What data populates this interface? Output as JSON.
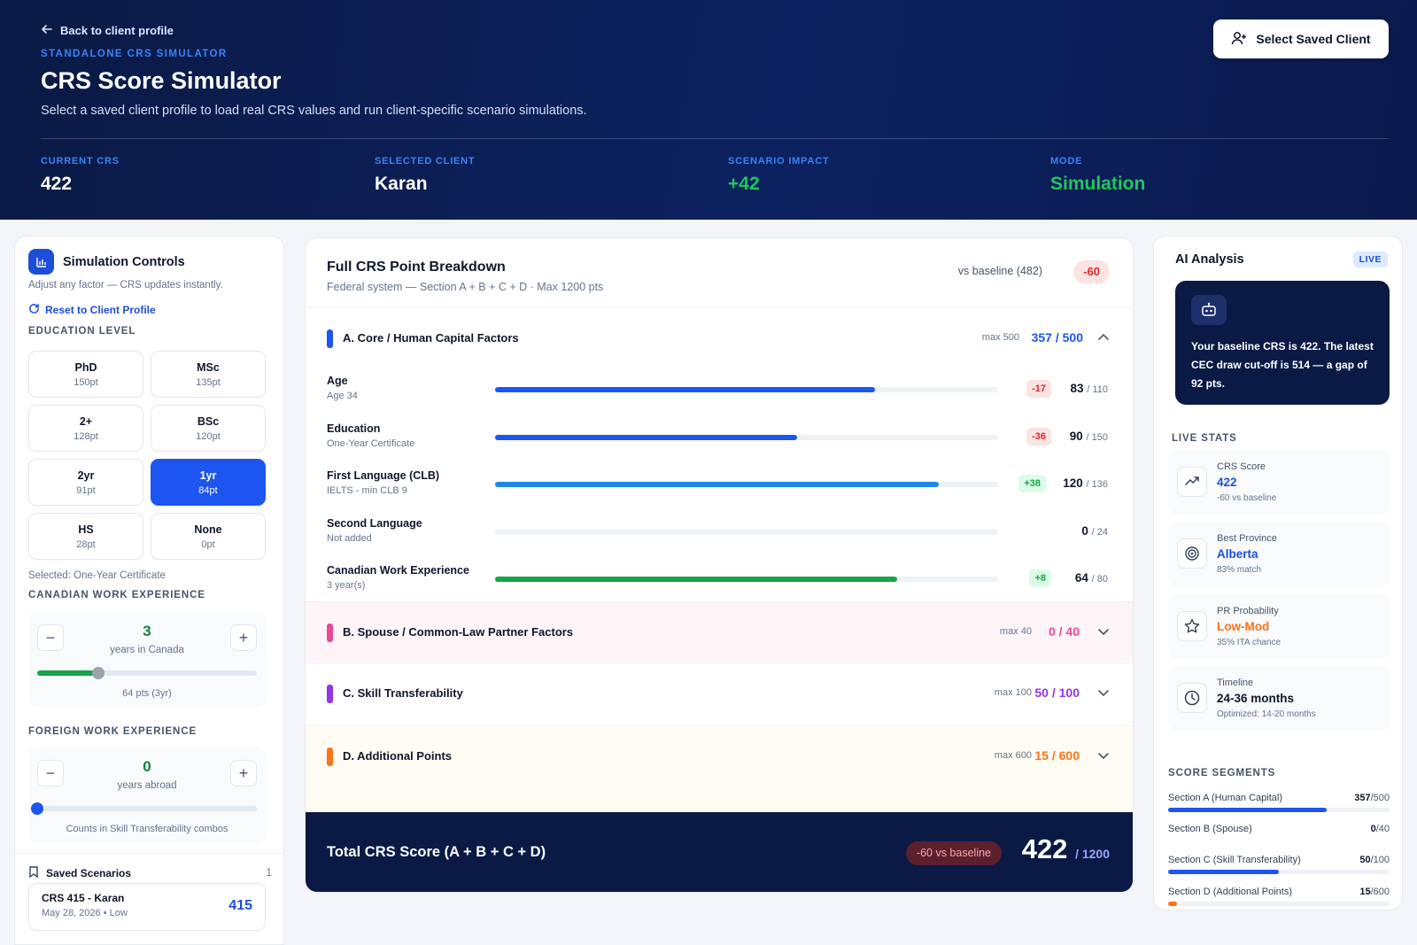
{
  "header": {
    "back_label": "Back to client profile",
    "eyebrow": "STANDALONE CRS SIMULATOR",
    "title": "CRS Score Simulator",
    "subtitle": "Select a saved client profile to load real CRS values and run client-specific scenario simulations.",
    "select_client_label": "Select Saved Client",
    "stats": [
      {
        "label": "CURRENT CRS",
        "value": "422"
      },
      {
        "label": "SELECTED CLIENT",
        "value": "Karan"
      },
      {
        "label": "SCENARIO IMPACT",
        "value": "+42"
      },
      {
        "label": "MODE",
        "value": "Simulation"
      }
    ]
  },
  "controls": {
    "title": "Simulation Controls",
    "description": "Adjust any factor — CRS updates instantly.",
    "reset_label": "Reset to Client Profile",
    "education_label": "EDUCATION LEVEL",
    "education_options": [
      {
        "name": "PhD",
        "points": "150pt"
      },
      {
        "name": "MSc",
        "points": "135pt"
      },
      {
        "name": "2+",
        "points": "128pt"
      },
      {
        "name": "BSc",
        "points": "120pt"
      },
      {
        "name": "2yr",
        "points": "91pt"
      },
      {
        "name": "1yr",
        "points": "84pt"
      },
      {
        "name": "HS",
        "points": "28pt"
      },
      {
        "name": "None",
        "points": "0pt"
      }
    ],
    "education_selected_index": 5,
    "education_selected_note": "Selected: One-Year Certificate",
    "canadian_work": {
      "label": "CANADIAN WORK EXPERIENCE",
      "value": "3",
      "unit": "years in Canada",
      "note": "64 pts (3yr)",
      "level": 0.28
    },
    "foreign_work": {
      "label": "FOREIGN WORK EXPERIENCE",
      "value": "0",
      "unit": "years abroad",
      "note": "Counts in Skill Transferability combos",
      "level": 0
    },
    "saved": {
      "label": "Saved Scenarios",
      "count": "1",
      "items": [
        {
          "title": "CRS 415 - Karan",
          "meta": "May 28, 2026 • Low",
          "score": "415"
        }
      ]
    }
  },
  "breakdown": {
    "title": "Full CRS Point Breakdown",
    "subtitle": "Federal system — Section A + B + C + D · Max 1200 pts",
    "vs_label": "vs baseline (482)",
    "vs_delta": "-60",
    "sections": [
      {
        "name": "A. Core / Human Capital Factors",
        "max": "max 500",
        "score": "357 / 500",
        "color": "#1d55f0"
      },
      {
        "name": "B. Spouse / Common-Law Partner Factors",
        "max": "max 40",
        "score": "0 / 40",
        "color": "#ec4899"
      },
      {
        "name": "C. Skill Transferability",
        "max": "max 100",
        "score": "50 / 100",
        "color": "#9333ea"
      },
      {
        "name": "D. Additional Points",
        "max": "max 600",
        "score": "15 / 600",
        "color": "#f97316"
      }
    ],
    "factors": [
      {
        "name": "Age",
        "detail": "Age 34",
        "delta": "-17",
        "score": "83",
        "max": "/ 110",
        "value": 83,
        "max_value": 110,
        "color": "#1d55f0"
      },
      {
        "name": "Education",
        "detail": "One-Year Certificate",
        "delta": "-36",
        "score": "90",
        "max": "/ 150",
        "value": 90,
        "max_value": 150,
        "color": "#1d55f0"
      },
      {
        "name": "First Language (CLB)",
        "detail": "IELTS - min CLB 9",
        "delta": "+38",
        "score": "120",
        "max": "/ 136",
        "value": 120,
        "max_value": 136,
        "color": "#1e88e5"
      },
      {
        "name": "Second Language",
        "detail": "Not added",
        "delta": "",
        "score": "0",
        "max": "/ 24",
        "value": 0,
        "max_value": 24,
        "color": "#1d55f0"
      },
      {
        "name": "Canadian Work Experience",
        "detail": "3 year(s)",
        "delta": "+8",
        "score": "64",
        "max": "/ 80",
        "value": 64,
        "max_value": 80,
        "color": "#16a34a"
      }
    ],
    "total_label": "Total CRS Score (A + B + C + D)",
    "total_delta": "-60 vs baseline",
    "total_score": "422",
    "total_max": "/ 1200"
  },
  "ai": {
    "title": "AI Analysis",
    "badge": "LIVE",
    "message": "Your baseline CRS is 422. The latest CEC draw cut-off is 514 — a gap of 92 pts.",
    "live_stats_label": "LIVE STATS",
    "live_stats": [
      {
        "key": "CRS Score",
        "value": "422",
        "sub": "-60 vs baseline",
        "color": "#1d4ed8",
        "icon": "trend-up-icon"
      },
      {
        "key": "Best Province",
        "value": "Alberta",
        "sub": "83% match",
        "color": "#1d4ed8",
        "icon": "target-icon"
      },
      {
        "key": "PR Probability",
        "value": "Low-Mod",
        "sub": "35% ITA chance",
        "color": "#f97316",
        "icon": "star-icon"
      },
      {
        "key": "Timeline",
        "value": "24-36 months",
        "sub": "Optimized: 14-20 months",
        "color": "#0f172a",
        "icon": "clock-icon"
      }
    ],
    "segments_label": "SCORE SEGMENTS",
    "segments": [
      {
        "name": "Section A (Human Capital)",
        "value": "357",
        "max": "/500",
        "v": 357,
        "m": 500,
        "color": "#1d55f0"
      },
      {
        "name": "Section B (Spouse)",
        "value": "0",
        "max": "/40",
        "v": 0,
        "m": 40,
        "color": "#ec4899"
      },
      {
        "name": "Section C (Skill Transferability)",
        "value": "50",
        "max": "/100",
        "v": 50,
        "m": 100,
        "color": "#1d55f0"
      },
      {
        "name": "Section D (Additional Points)",
        "value": "15",
        "max": "/600",
        "v": 15,
        "m": 600,
        "color": "#f97316"
      }
    ]
  }
}
